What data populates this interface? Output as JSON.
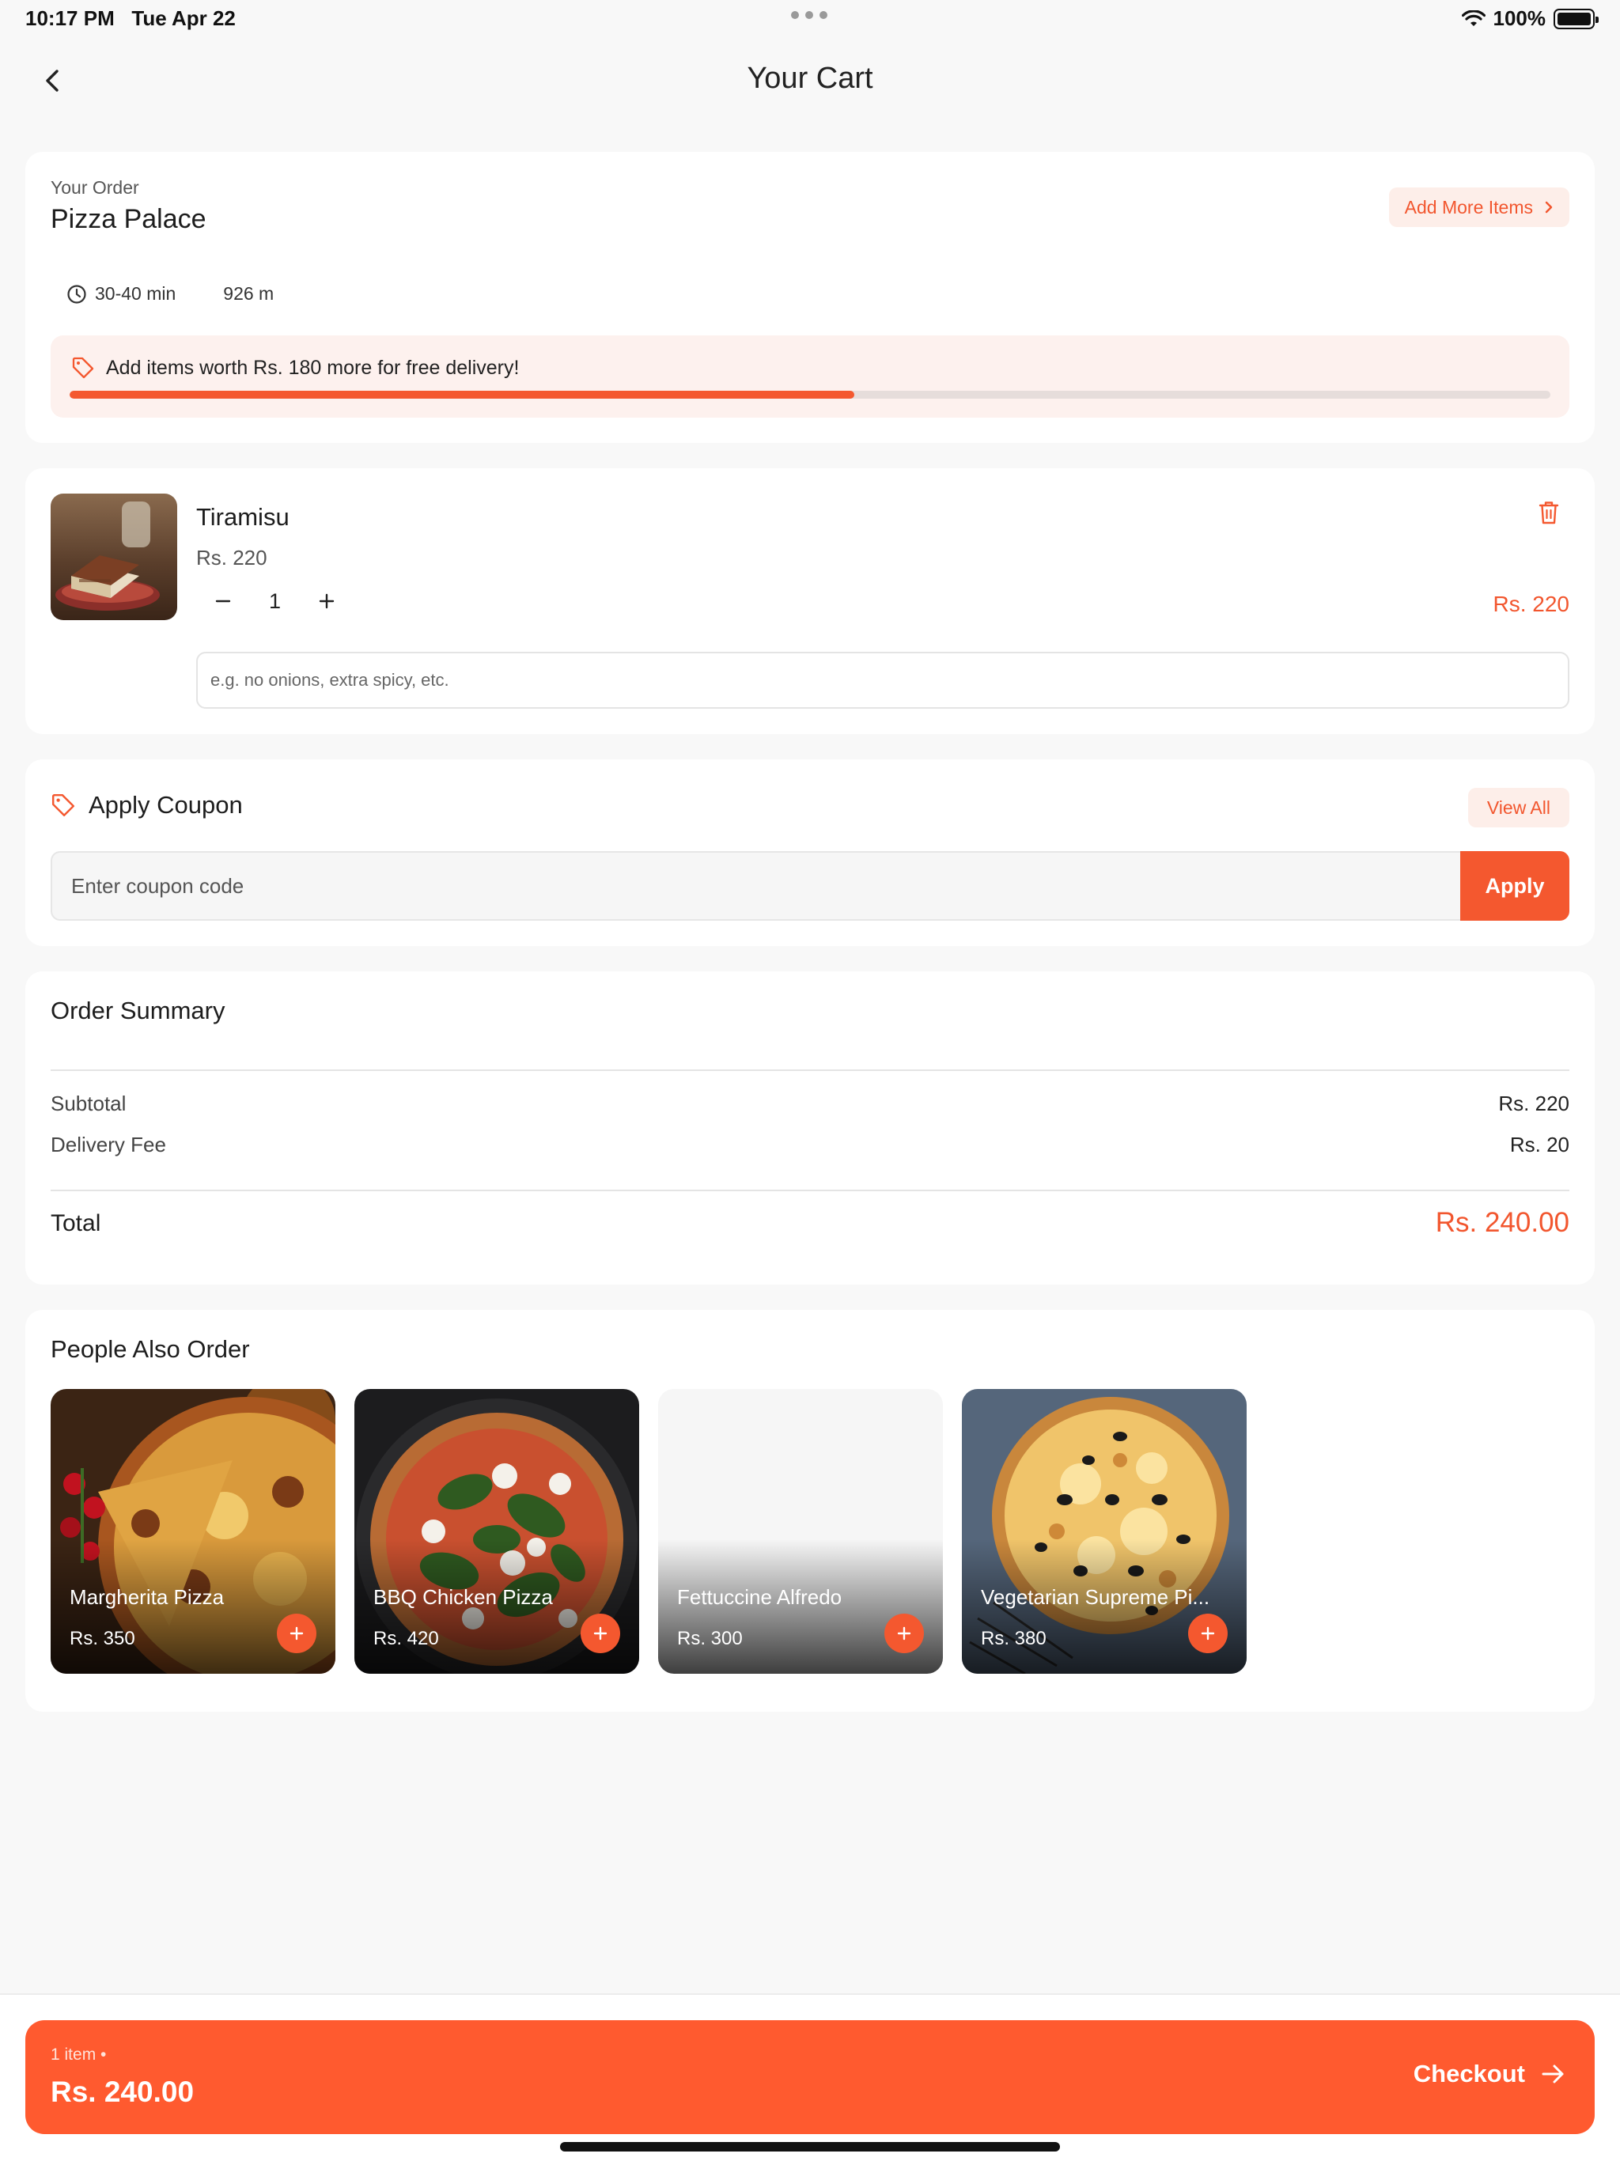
{
  "status_bar": {
    "time": "10:17 PM",
    "date": "Tue Apr 22",
    "battery": "100%"
  },
  "header": {
    "title": "Your Cart"
  },
  "order": {
    "label": "Your Order",
    "restaurant": "Pizza Palace",
    "add_more_label": "Add More Items",
    "eta": "30-40 min",
    "distance": "926 m",
    "free_delivery_text": "Add items worth Rs. 180 more for free delivery!",
    "free_delivery_progress": 0.53
  },
  "cart_items": [
    {
      "name": "Tiramisu",
      "unit_price": "Rs. 220",
      "quantity": "1",
      "line_total": "Rs. 220",
      "note_placeholder": "e.g. no onions, extra spicy, etc."
    }
  ],
  "coupon": {
    "title": "Apply Coupon",
    "view_all_label": "View All",
    "placeholder": "Enter coupon code",
    "apply_label": "Apply"
  },
  "summary": {
    "title": "Order Summary",
    "subtotal_label": "Subtotal",
    "subtotal_value": "Rs. 220",
    "delivery_label": "Delivery Fee",
    "delivery_value": "Rs. 20",
    "total_label": "Total",
    "total_value": "Rs. 240.00"
  },
  "recommendations": {
    "title": "People Also Order",
    "items": [
      {
        "name": "Margherita Pizza",
        "price": "Rs. 350"
      },
      {
        "name": "BBQ Chicken Pizza",
        "price": "Rs. 420"
      },
      {
        "name": "Fettuccine Alfredo",
        "price": "Rs. 300"
      },
      {
        "name": "Vegetarian Supreme Pi...",
        "price": "Rs. 380"
      }
    ]
  },
  "checkout": {
    "items_label": "1 item •",
    "total": "Rs. 240.00",
    "action_label": "Checkout"
  },
  "colors": {
    "accent": "#f4582f",
    "accent_soft": "#fdeee9",
    "background": "#f8f8f8"
  }
}
